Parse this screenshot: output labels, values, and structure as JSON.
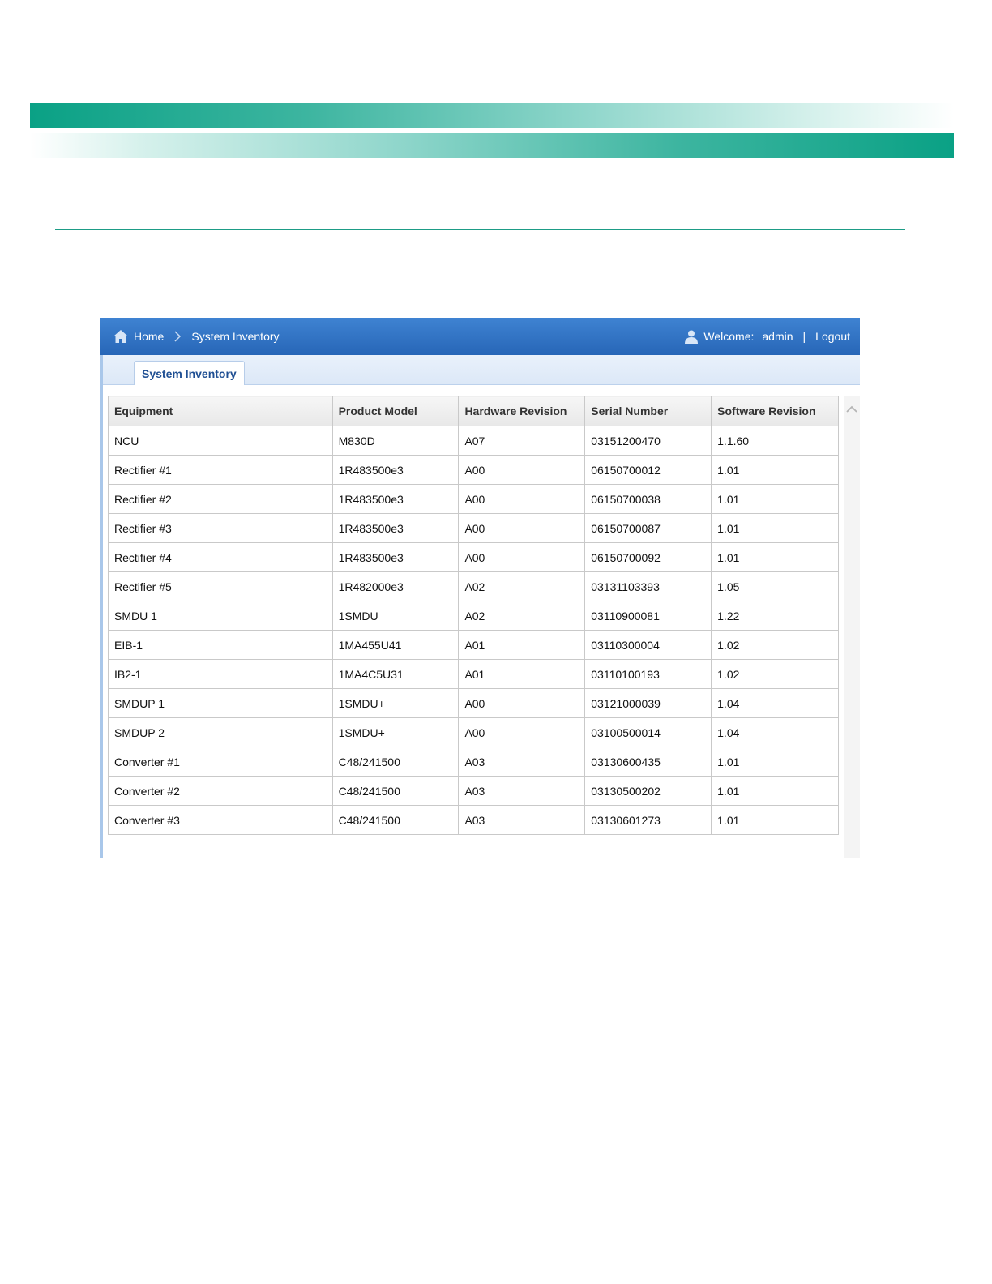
{
  "breadcrumb": {
    "home_label": "Home",
    "separator": ">",
    "current_label": "System Inventory"
  },
  "user": {
    "welcome_label": "Welcome:",
    "username": "admin",
    "divider": "|",
    "logout_label": "Logout"
  },
  "tabs": [
    {
      "label": "System Inventory",
      "active": true
    }
  ],
  "table": {
    "columns": [
      "Equipment",
      "Product Model",
      "Hardware Revision",
      "Serial Number",
      "Software Revision"
    ],
    "rows": [
      [
        "NCU",
        "M830D",
        "A07",
        "03151200470",
        "1.1.60"
      ],
      [
        "Rectifier #1",
        "1R483500e3",
        "A00",
        "06150700012",
        "1.01"
      ],
      [
        "Rectifier #2",
        "1R483500e3",
        "A00",
        "06150700038",
        "1.01"
      ],
      [
        "Rectifier #3",
        "1R483500e3",
        "A00",
        "06150700087",
        "1.01"
      ],
      [
        "Rectifier #4",
        "1R483500e3",
        "A00",
        "06150700092",
        "1.01"
      ],
      [
        "Rectifier #5",
        "1R482000e3",
        "A02",
        "03131103393",
        "1.05"
      ],
      [
        "SMDU 1",
        "1SMDU",
        "A02",
        "03110900081",
        "1.22"
      ],
      [
        "EIB-1",
        "1MA455U41",
        "A01",
        "03110300004",
        "1.02"
      ],
      [
        "IB2-1",
        "1MA4C5U31",
        "A01",
        "03110100193",
        "1.02"
      ],
      [
        "SMDUP 1",
        "1SMDU+",
        "A00",
        "03121000039",
        "1.04"
      ],
      [
        "SMDUP 2",
        "1SMDU+",
        "A00",
        "03100500014",
        "1.04"
      ],
      [
        "Converter #1",
        "C48/241500",
        "A03",
        "03130600435",
        "1.01"
      ],
      [
        "Converter #2",
        "C48/241500",
        "A03",
        "03130500202",
        "1.01"
      ],
      [
        "Converter #3",
        "C48/241500",
        "A03",
        "03130601273",
        "1.01"
      ]
    ]
  },
  "icons": {
    "home": "home-icon",
    "user": "user-icon",
    "scroll_up": "chevron-up-icon"
  },
  "colors": {
    "brand_teal": "#0aa185",
    "topbar_blue": "#2766b7",
    "tab_text": "#1f4f93"
  }
}
